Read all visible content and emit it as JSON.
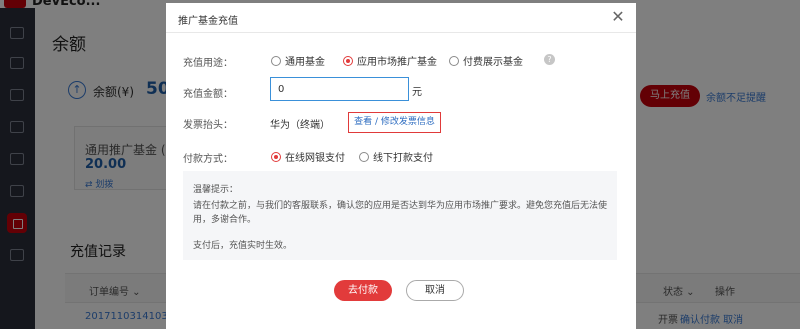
{
  "app": {
    "brand": "DevEco..."
  },
  "page": {
    "title": "余额",
    "balance_label": "余额(¥)",
    "balance_value": "50",
    "recharge_button": "马上充值",
    "balance_reminder_link": "余额不足提醒",
    "card": {
      "title": "通用推广基金 (¥",
      "value": "20.00",
      "link": "⇄ 划拨"
    },
    "records_title": "充值记录",
    "table": {
      "col_order": "订单编号 ⌄",
      "col_status": "状态 ⌄",
      "col_operation": "操作",
      "row": {
        "order_no": "20171103141033111",
        "status": "开票",
        "actions": "确认付款 取消"
      }
    }
  },
  "modal": {
    "title": "推广基金充值",
    "purpose_label": "充值用途：",
    "purpose_options": [
      "通用基金",
      "应用市场推广基金",
      "付费展示基金"
    ],
    "purpose_selected": "应用市场推广基金",
    "amount_label": "充值金额：",
    "amount_value": "0",
    "amount_unit": "元",
    "invoice_label": "发票抬头：",
    "invoice_value": "华为（终端）",
    "invoice_link": "查看 / 修改发票信息",
    "payment_label": "付款方式：",
    "payment_options": [
      "在线网银支付",
      "线下打款支付"
    ],
    "payment_selected": "在线网银支付",
    "notice_title": "温馨提示：",
    "notice_body": "请在付款之前，与我们的客服联系，确认您的应用是否达到华为应用市场推广要求。避免您充值后无法使用，多谢合作。",
    "notice_footer": "支付后，充值实时生效。",
    "pay_button": "去付款",
    "cancel_button": "取消"
  },
  "colors": {
    "primary_red": "#e23b3b",
    "link_blue": "#2d6cc0",
    "input_border": "#3a90d9"
  }
}
